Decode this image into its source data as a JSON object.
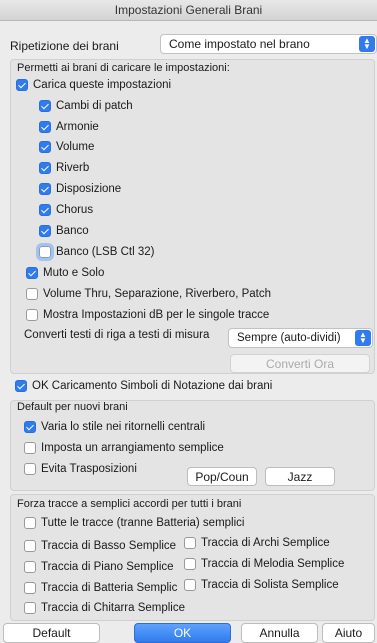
{
  "window": {
    "title": "Impostazioni Generali Brani"
  },
  "repeat": {
    "label": "Ripetizione dei brani",
    "value": "Come impostato nel brano"
  },
  "permit": {
    "header": "Permetti ai brani di caricare le impostazioni:",
    "load": {
      "label": "Carica queste impostazioni",
      "checked": true
    },
    "items": [
      {
        "label": "Cambi di patch",
        "checked": true
      },
      {
        "label": "Armonie",
        "checked": true
      },
      {
        "label": "Volume",
        "checked": true
      },
      {
        "label": "Riverb",
        "checked": true
      },
      {
        "label": "Disposizione",
        "checked": true
      },
      {
        "label": "Chorus",
        "checked": true
      },
      {
        "label": "Banco",
        "checked": true
      },
      {
        "label": "Banco (LSB Ctl 32)",
        "checked": false
      }
    ],
    "mute": {
      "label": "Muto e Solo",
      "checked": true
    },
    "volthru": {
      "label": "Volume Thru, Separazione, Riverbero, Patch",
      "checked": false
    },
    "showdb": {
      "label": "Mostra Impostazioni dB per le singole tracce",
      "checked": false
    },
    "convert": {
      "label": "Converti testi di riga a testi di misura",
      "value": "Sempre (auto-dividi)",
      "button": "Converti Ora"
    }
  },
  "notation": {
    "label": "OK Caricamento Simboli di Notazione dai brani",
    "checked": true
  },
  "defaults": {
    "header": "Default per nuovi brani",
    "vary": {
      "label": "Varia lo stile nei ritornelli centrali",
      "checked": true
    },
    "simple": {
      "label": "Imposta un arrangiamento semplice",
      "checked": false
    },
    "transpose": {
      "label": "Evita Trasposizioni",
      "checked": false
    },
    "pop_button": "Pop/Coun",
    "jazz_button": "Jazz"
  },
  "simpleTracks": {
    "header": "Forza tracce a semplici accordi per tutti i brani",
    "all": {
      "label": "Tutte le tracce (tranne Batteria) semplici",
      "checked": false
    },
    "bass": {
      "label": "Traccia di Basso Semplice",
      "checked": false
    },
    "piano": {
      "label": "Traccia di Piano Semplice",
      "checked": false
    },
    "drums": {
      "label": "Traccia di Batteria Semplic",
      "checked": false
    },
    "guitar": {
      "label": "Traccia di Chitarra Semplice",
      "checked": false
    },
    "strings": {
      "label": "Traccia di Archi Semplice",
      "checked": false
    },
    "melody": {
      "label": "Traccia di Melodia Semplice",
      "checked": false
    },
    "soloist": {
      "label": "Traccia di Solista Semplice",
      "checked": false
    }
  },
  "footer": {
    "default": "Default",
    "ok": "OK",
    "cancel": "Annulla",
    "help": "Aiuto"
  }
}
